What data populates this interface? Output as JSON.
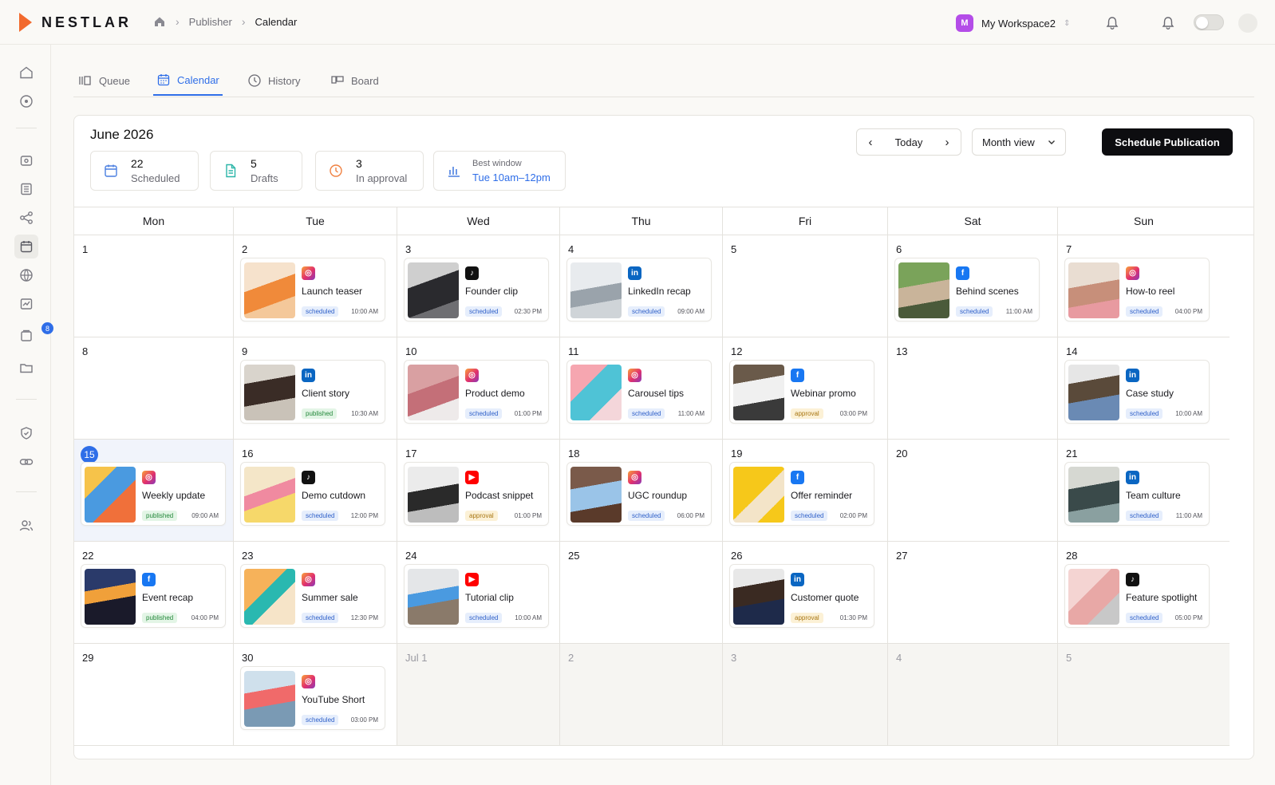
{
  "brand": {
    "name": "NESTLAR",
    "accent": "#f26a2e"
  },
  "breadcrumb": {
    "items": [
      "Publisher",
      "Calendar"
    ]
  },
  "workspace": {
    "avatar_letter": "M",
    "name": "My Workspace2",
    "avatar_color": "#b44de8"
  },
  "sidebar": {
    "notification_count": "8"
  },
  "tabs": [
    {
      "label": "Queue",
      "icon": "queue-icon",
      "active": false
    },
    {
      "label": "Calendar",
      "icon": "calendar-icon",
      "active": true
    },
    {
      "label": "History",
      "icon": "clock-icon",
      "active": false
    },
    {
      "label": "Board",
      "icon": "board-icon",
      "active": false
    }
  ],
  "header": {
    "month": "June 2026"
  },
  "stats": {
    "scheduled": {
      "value": "22",
      "label": "Scheduled"
    },
    "drafts": {
      "value": "5",
      "label": "Drafts"
    },
    "approval": {
      "value": "3",
      "label": "In approval"
    },
    "window": {
      "label": "Best window",
      "value": "Tue 10am–12pm"
    }
  },
  "controls": {
    "today": "Today",
    "view": "Month view",
    "primary": "Schedule Publication"
  },
  "weekdays": [
    "Mon",
    "Tue",
    "Wed",
    "Thu",
    "Fri",
    "Sat",
    "Sun"
  ],
  "colors": {
    "instagram": "#e1306c",
    "tiktok": "#111111",
    "linkedin": "#0a66c2",
    "facebook": "#1877f2",
    "youtube": "#ff0000",
    "primary": "#2f6ee8"
  },
  "days": [
    {
      "num": "1"
    },
    {
      "num": "2",
      "post": {
        "network": "instagram",
        "title": "Launch teaser",
        "status": "scheduled",
        "time": "10:00 AM",
        "thumb": "bottles"
      }
    },
    {
      "num": "3",
      "post": {
        "network": "tiktok",
        "title": "Founder clip",
        "status": "scheduled",
        "time": "02:30 PM",
        "thumb": "camera"
      }
    },
    {
      "num": "4",
      "post": {
        "network": "linkedin",
        "title": "LinkedIn recap",
        "status": "scheduled",
        "time": "09:00 AM",
        "thumb": "laptop"
      }
    },
    {
      "num": "5"
    },
    {
      "num": "6",
      "post": {
        "network": "facebook",
        "title": "Behind scenes",
        "status": "scheduled",
        "time": "11:00 AM",
        "thumb": "team-outdoor"
      }
    },
    {
      "num": "7",
      "post": {
        "network": "instagram",
        "title": "How-to reel",
        "status": "scheduled",
        "time": "04:00 PM",
        "thumb": "woman-phone"
      }
    },
    {
      "num": "8"
    },
    {
      "num": "9",
      "post": {
        "network": "linkedin",
        "title": "Client story",
        "status": "published",
        "time": "10:30 AM",
        "thumb": "woman-portrait"
      }
    },
    {
      "num": "10",
      "post": {
        "network": "instagram",
        "title": "Product demo",
        "status": "scheduled",
        "time": "01:00 PM",
        "thumb": "device"
      }
    },
    {
      "num": "11",
      "post": {
        "network": "instagram",
        "title": "Carousel tips",
        "status": "scheduled",
        "time": "11:00 AM",
        "thumb": "phones"
      }
    },
    {
      "num": "12",
      "post": {
        "network": "facebook",
        "title": "Webinar promo",
        "status": "approval",
        "time": "03:00 PM",
        "thumb": "webinar"
      }
    },
    {
      "num": "13"
    },
    {
      "num": "14",
      "post": {
        "network": "linkedin",
        "title": "Case study",
        "status": "scheduled",
        "time": "10:00 AM",
        "thumb": "man-portrait"
      }
    },
    {
      "num": "15",
      "today": true,
      "post": {
        "network": "instagram",
        "title": "Weekly update",
        "status": "published",
        "time": "09:00 AM",
        "thumb": "colorful-laptop"
      }
    },
    {
      "num": "16",
      "post": {
        "network": "tiktok",
        "title": "Demo cutdown",
        "status": "scheduled",
        "time": "12:00 PM",
        "thumb": "flowers"
      }
    },
    {
      "num": "17",
      "post": {
        "network": "youtube",
        "title": "Podcast snippet",
        "status": "approval",
        "time": "01:00 PM",
        "thumb": "headphones"
      }
    },
    {
      "num": "18",
      "post": {
        "network": "instagram",
        "title": "UGC roundup",
        "status": "scheduled",
        "time": "06:00 PM",
        "thumb": "hand-phone"
      }
    },
    {
      "num": "19",
      "post": {
        "network": "facebook",
        "title": "Offer reminder",
        "status": "scheduled",
        "time": "02:00 PM",
        "thumb": "megaphone"
      }
    },
    {
      "num": "20"
    },
    {
      "num": "21",
      "post": {
        "network": "linkedin",
        "title": "Team culture",
        "status": "scheduled",
        "time": "11:00 AM",
        "thumb": "team-office"
      }
    },
    {
      "num": "22",
      "post": {
        "network": "facebook",
        "title": "Event recap",
        "status": "published",
        "time": "04:00 PM",
        "thumb": "concert"
      }
    },
    {
      "num": "23",
      "post": {
        "network": "instagram",
        "title": "Summer sale",
        "status": "scheduled",
        "time": "12:30 PM",
        "thumb": "summer"
      }
    },
    {
      "num": "24",
      "post": {
        "network": "youtube",
        "title": "Tutorial clip",
        "status": "scheduled",
        "time": "10:00 AM",
        "thumb": "laptop-desk"
      }
    },
    {
      "num": "25"
    },
    {
      "num": "26",
      "post": {
        "network": "linkedin",
        "title": "Customer quote",
        "status": "approval",
        "time": "01:30 PM",
        "thumb": "woman-smile"
      }
    },
    {
      "num": "27"
    },
    {
      "num": "28",
      "post": {
        "network": "tiktok",
        "title": "Feature spotlight",
        "status": "scheduled",
        "time": "05:00 PM",
        "thumb": "cosmetics"
      }
    },
    {
      "num": "29"
    },
    {
      "num": "30",
      "post": {
        "network": "instagram",
        "title": "YouTube Short",
        "status": "scheduled",
        "time": "03:00 PM",
        "thumb": "phone-hand"
      }
    },
    {
      "num": "Jul 1",
      "muted": true
    },
    {
      "num": "2",
      "muted": true
    },
    {
      "num": "3",
      "muted": true
    },
    {
      "num": "4",
      "muted": true
    },
    {
      "num": "5",
      "muted": true
    }
  ]
}
